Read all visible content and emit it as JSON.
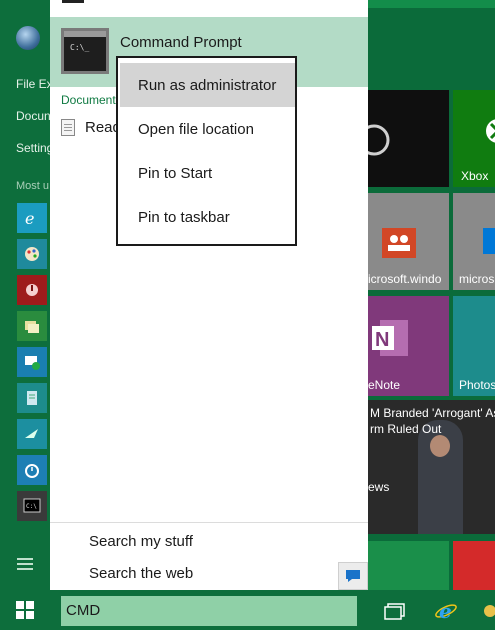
{
  "colors": {
    "accent": "#0d6e3c",
    "highlight": "#b3dbc6",
    "search_box": "#8fd0a7",
    "menu_highlight": "#d4d4d4"
  },
  "left_menu": {
    "labels": [
      "File Ex",
      "Docun",
      "Setting"
    ],
    "most_used_label": "Most u",
    "apps": [
      {
        "icon": "internet-explorer-icon",
        "color": "#1b9cc0"
      },
      {
        "icon": "paint-icon",
        "color": "#1f8a9c"
      },
      {
        "icon": "red-app-icon",
        "color": "#9e1b1b"
      },
      {
        "icon": "photos-app-icon",
        "color": "#2a8c3e"
      },
      {
        "icon": "remote-desktop-icon",
        "color": "#1a7fb0"
      },
      {
        "icon": "notepad-icon",
        "color": "#1d8c8c"
      },
      {
        "icon": "snipping-tool-icon",
        "color": "#1c8fa0"
      },
      {
        "icon": "alarms-icon",
        "color": "#1d7fb4"
      },
      {
        "icon": "cmd-icon",
        "color": "#3a3a3a"
      }
    ]
  },
  "best_match": {
    "title": "Command Prompt",
    "icon": "command-prompt-icon",
    "icon_text": "C:\\_"
  },
  "documents": {
    "header": "Document",
    "items": [
      {
        "label": "Read",
        "icon": "document-icon"
      }
    ]
  },
  "context_menu": {
    "items": [
      {
        "label": "Run as administrator",
        "highlighted": true
      },
      {
        "label": "Open file location",
        "highlighted": false
      },
      {
        "label": "Pin to Start",
        "highlighted": false
      },
      {
        "label": "Pin to taskbar",
        "highlighted": false
      }
    ]
  },
  "search_links": {
    "my_stuff": "Search my stuff",
    "web": "Search the web"
  },
  "taskbar": {
    "search_value": "CMD"
  },
  "tiles": {
    "xbox_label": "Xbox",
    "people_label": "icrosoft.windo",
    "mail_label": "micros",
    "onenote_label": "eNote",
    "photos_label": "Photos",
    "news_headline_1": "M Branded 'Arrogant' As",
    "news_headline_2": "rm Ruled Out",
    "news_label": "ews"
  }
}
